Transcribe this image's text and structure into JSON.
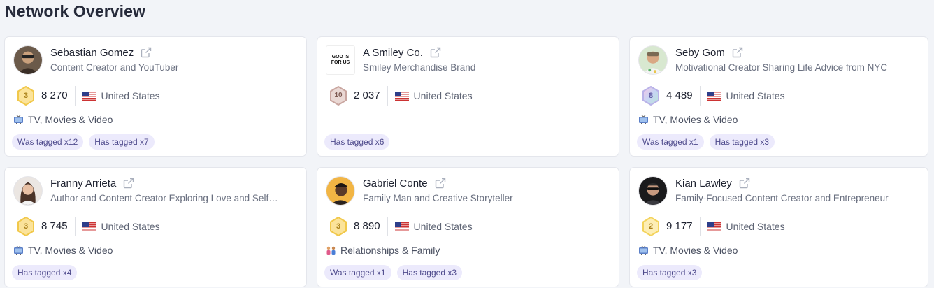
{
  "page": {
    "title": "Network Overview"
  },
  "cards": [
    {
      "name": "Sebastian Gomez",
      "description": "Content Creator and YouTuber",
      "level": "3",
      "count": "8 270",
      "country": "United States",
      "category": "TV, Movies & Video",
      "tags": [
        "Was tagged x12",
        "Has tagged x7"
      ]
    },
    {
      "name": "A Smiley Co.",
      "description": "Smiley Merchandise Brand",
      "logo_text": "GOD IS FOR US",
      "level": "10",
      "count": "2 037",
      "country": "United States",
      "category": "",
      "tags": [
        "Has tagged x6"
      ]
    },
    {
      "name": "Seby Gom",
      "description": "Motivational Creator Sharing Life Advice from NYC",
      "level": "8",
      "count": "4 489",
      "country": "United States",
      "category": "TV, Movies & Video",
      "tags": [
        "Was tagged x1",
        "Has tagged x3"
      ]
    },
    {
      "name": "Franny Arrieta",
      "description": "Author and Content Creator Exploring Love and Self…",
      "level": "3",
      "count": "8 745",
      "country": "United States",
      "category": "TV, Movies & Video",
      "tags": [
        "Has tagged x4"
      ]
    },
    {
      "name": "Gabriel Conte",
      "description": "Family Man and Creative Storyteller",
      "level": "3",
      "count": "8 890",
      "country": "United States",
      "category": "Relationships & Family",
      "tags": [
        "Was tagged x1",
        "Has tagged x3"
      ]
    },
    {
      "name": "Kian Lawley",
      "description": "Family-Focused Content Creator and Entrepreneur",
      "level": "2",
      "count": "9 177",
      "country": "United States",
      "category": "TV, Movies & Video",
      "tags": [
        "Has tagged x3"
      ]
    }
  ],
  "icons": {
    "external_link": "external-link-icon",
    "flag": "us-flag-icon",
    "tv": "tv-icon",
    "family": "family-icon"
  },
  "colors": {
    "gold_badge": "#f5c842",
    "bronze_badge": "#c9a6a0",
    "rainbow_badge": "#b9b2e8",
    "tag_bg": "#eceafc",
    "tag_text": "#4e4a8c"
  }
}
